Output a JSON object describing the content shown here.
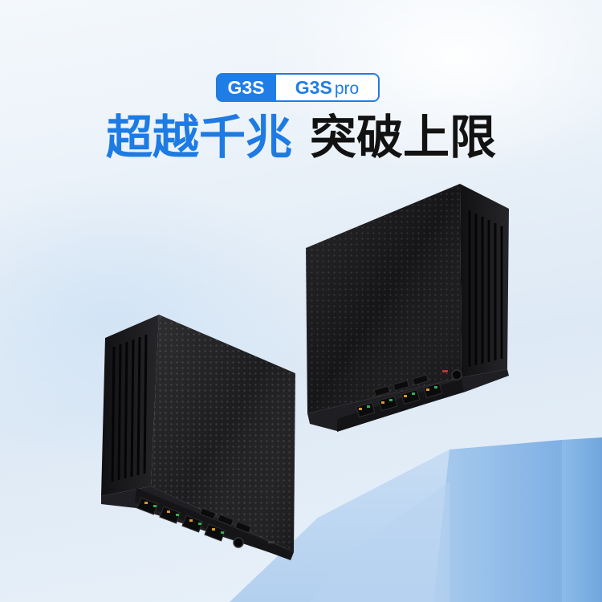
{
  "model_tabs": {
    "active": "G3S",
    "inactive": "G3S",
    "inactive_suffix": "pro"
  },
  "headline": {
    "highlight": "超越千兆",
    "rest": "突破上限"
  },
  "colors": {
    "accent": "#1f7de6",
    "headline_blue": "#1d7be3",
    "headline_dark": "#121212",
    "background": "#e8f0f8",
    "device_body": "#1c1c1e",
    "platform": "#9ec4ea"
  }
}
